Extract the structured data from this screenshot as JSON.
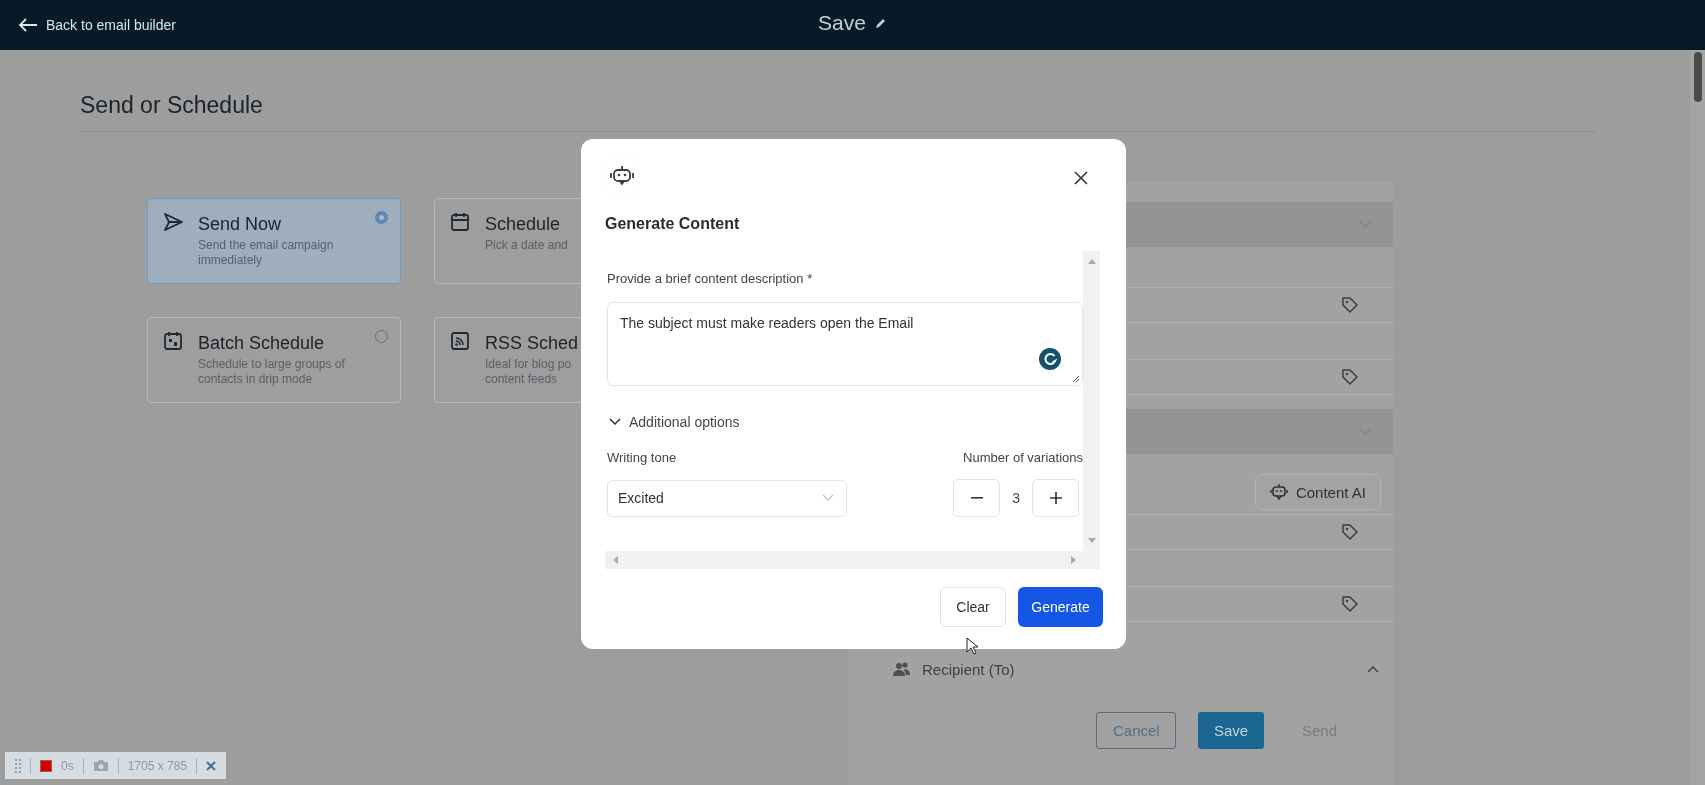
{
  "top_bar": {
    "back_link": "Back to email builder",
    "title": "Save"
  },
  "page": {
    "title": "Send or Schedule"
  },
  "send_options": [
    {
      "kind": "send",
      "title": "Send Now",
      "description": "Send the email campaign immediately",
      "selected": true
    },
    {
      "kind": "calendar",
      "title": "Schedule",
      "description": "Pick a date and",
      "selected": false
    },
    {
      "kind": "batch",
      "title": "Batch Schedule",
      "description": "Schedule to large groups of contacts in drip mode",
      "selected": false
    },
    {
      "kind": "rss",
      "title": "RSS Sched",
      "description": "Ideal for blog po content feeds",
      "selected": false
    }
  ],
  "settings_panel": {
    "rows": [
      {
        "kind": "section",
        "expanded": false
      },
      {
        "kind": "field"
      },
      {
        "kind": "field"
      },
      {
        "kind": "section",
        "expanded": false
      },
      {
        "kind": "ai_button",
        "label": "Content AI"
      },
      {
        "kind": "field"
      },
      {
        "kind": "field"
      },
      {
        "kind": "recipient",
        "label": "Recipient (To)",
        "expanded": true
      }
    ],
    "buttons": [
      {
        "kind": "outline",
        "label": "Cancel"
      },
      {
        "kind": "primary",
        "label": "Save"
      },
      {
        "kind": "text",
        "label": "Send"
      }
    ]
  },
  "modal": {
    "title": "Generate Content",
    "description_label": "Provide a brief content description *",
    "description_value": "The subject must make readers open the Email",
    "options_toggle": "Additional options",
    "options_expanded": true,
    "tone_label": "Writing tone",
    "tone_value": "Excited",
    "variations_label": "Number of variations",
    "variations_value": "3",
    "buttons": [
      {
        "kind": "secondary",
        "label": "Clear"
      },
      {
        "kind": "primary",
        "label": "Generate"
      }
    ]
  },
  "recorder": {
    "timer": "0s",
    "size": "1705 x 785"
  }
}
